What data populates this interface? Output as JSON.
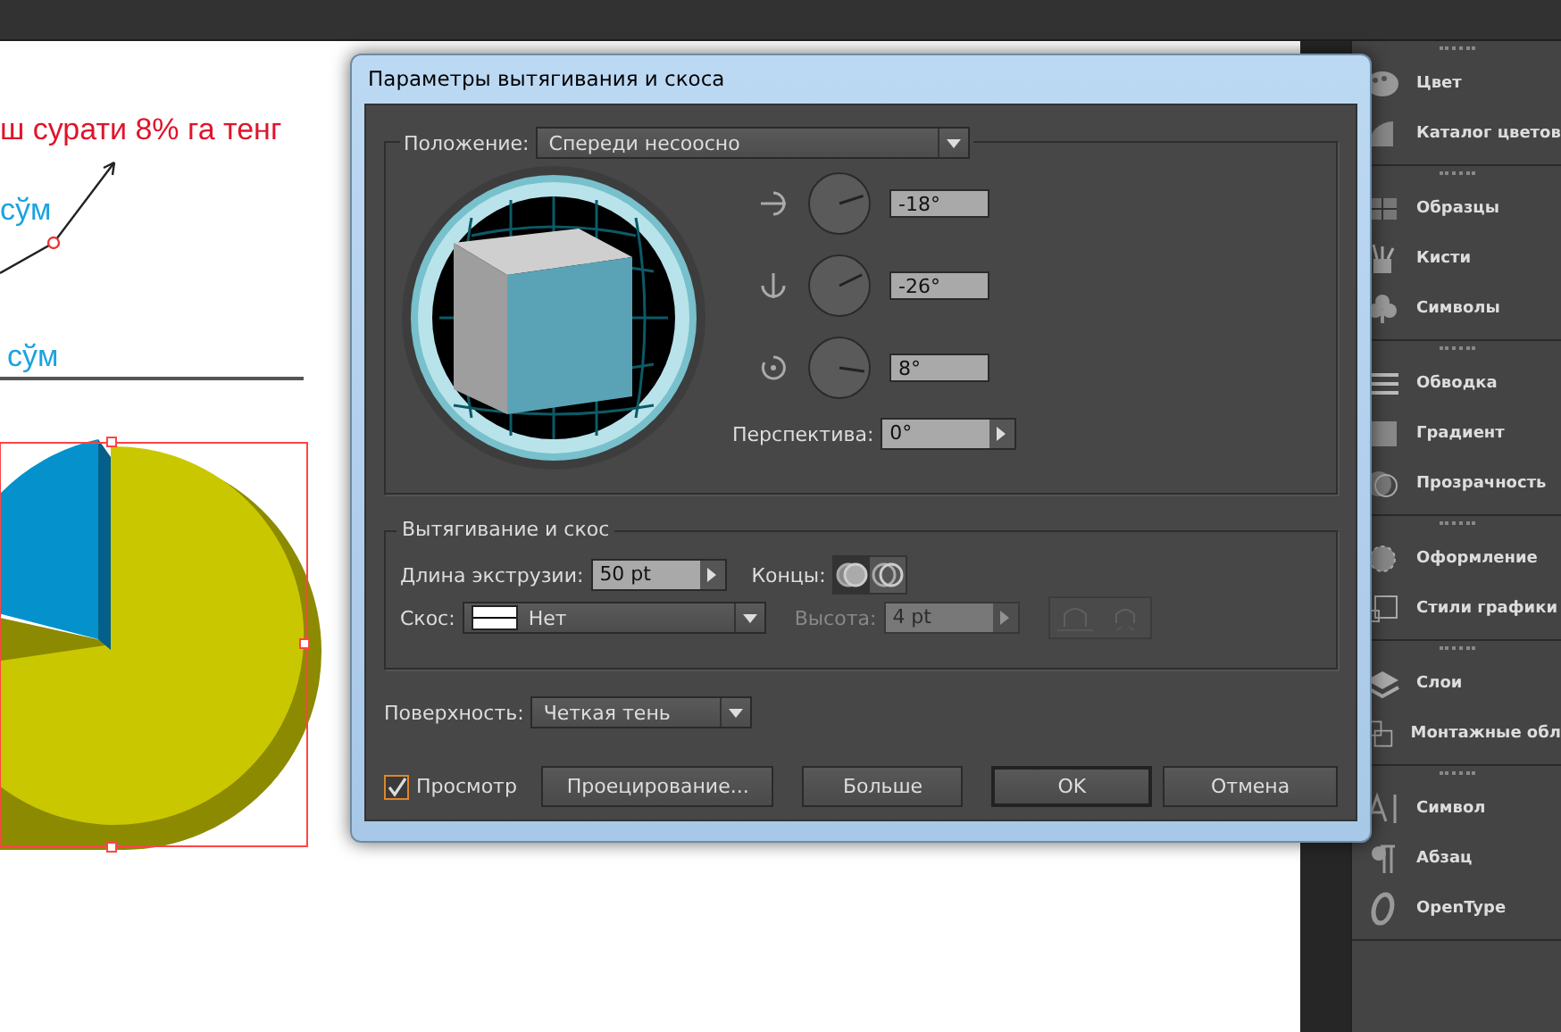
{
  "artboard": {
    "headline": "ш сурати 8% га тенг",
    "label_upper": "сўм",
    "label_lower": "сўм"
  },
  "dialog": {
    "title": "Параметры вытягивания и скоса",
    "position": {
      "label": "Положение:",
      "value": "Спереди несоосно"
    },
    "rotations": [
      {
        "kind": "x",
        "value": "-18°"
      },
      {
        "kind": "y",
        "value": "-26°"
      },
      {
        "kind": "z",
        "value": "8°"
      }
    ],
    "perspective": {
      "label": "Перспектива:",
      "value": "0°"
    },
    "extrude": {
      "title": "Вытягивание и скос",
      "depth_label": "Длина экструзии:",
      "depth_value": "50 pt",
      "caps_label": "Концы:",
      "caps": [
        {
          "selected": true
        },
        {
          "selected": false
        }
      ],
      "bevel_label": "Скос:",
      "bevel_value": "Нет",
      "height_label": "Высота:",
      "height_value": "4 pt",
      "height_disabled": true
    },
    "surface": {
      "label": "Поверхность:",
      "value": "Четкая тень"
    },
    "preview": {
      "label": "Просмотр",
      "checked": true
    },
    "buttons": [
      {
        "label": "Проецирование...",
        "default": false
      },
      {
        "label": "Больше",
        "default": false
      },
      {
        "label": "OK",
        "default": true
      },
      {
        "label": "Отмена",
        "default": false
      }
    ]
  },
  "panels": [
    {
      "items": [
        {
          "kind": "palette",
          "label": "Цвет"
        },
        {
          "kind": "fan",
          "label": "Каталог цветов"
        }
      ]
    },
    {
      "items": [
        {
          "kind": "grid",
          "label": "Образцы"
        },
        {
          "kind": "brush",
          "label": "Кисти"
        },
        {
          "kind": "club",
          "label": "Символы"
        }
      ]
    },
    {
      "items": [
        {
          "kind": "lines",
          "label": "Обводка"
        },
        {
          "kind": "gradient",
          "label": "Градиент"
        },
        {
          "kind": "circles",
          "label": "Прозрачность"
        }
      ]
    },
    {
      "items": [
        {
          "kind": "dotcircle",
          "label": "Оформление"
        },
        {
          "kind": "squares",
          "label": "Стили графики"
        }
      ]
    },
    {
      "items": [
        {
          "kind": "layers",
          "label": "Слои"
        },
        {
          "kind": "boards",
          "label": "Монтажные обл"
        }
      ]
    },
    {
      "items": [
        {
          "kind": "letter",
          "label": "Символ"
        },
        {
          "kind": "pilcrow",
          "label": "Абзац"
        },
        {
          "kind": "italic",
          "label": "OpenType"
        }
      ]
    }
  ]
}
